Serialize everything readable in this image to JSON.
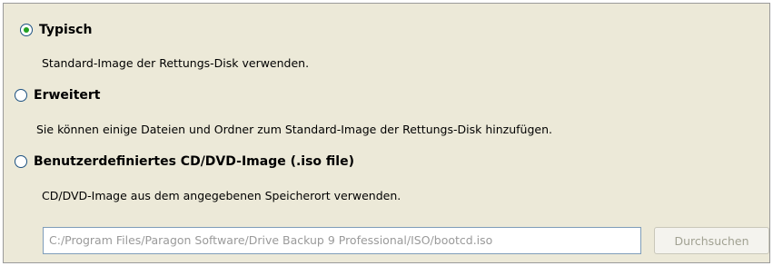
{
  "options": [
    {
      "label": "Typisch",
      "description": "Standard-Image der Rettungs-Disk verwenden.",
      "selected": true
    },
    {
      "label": "Erweitert",
      "description": "Sie können einige Dateien und Ordner zum Standard-Image der Rettungs-Disk hinzufügen.",
      "selected": false
    },
    {
      "label": "Benutzerdefiniertes CD/DVD-Image (.iso file)",
      "description": "CD/DVD-Image aus dem angegebenen Speicherort verwenden.",
      "selected": false
    }
  ],
  "iso_path": {
    "value": "C:/Program Files/Paragon Software/Drive Backup 9 Professional/ISO/bootcd.iso",
    "disabled": true
  },
  "browse_button": {
    "label": "Durchsuchen",
    "disabled": true
  },
  "colors": {
    "panel_background": "#ece9d8",
    "radio_dot": "#21a121",
    "disabled_text": "#9a9a9a"
  }
}
